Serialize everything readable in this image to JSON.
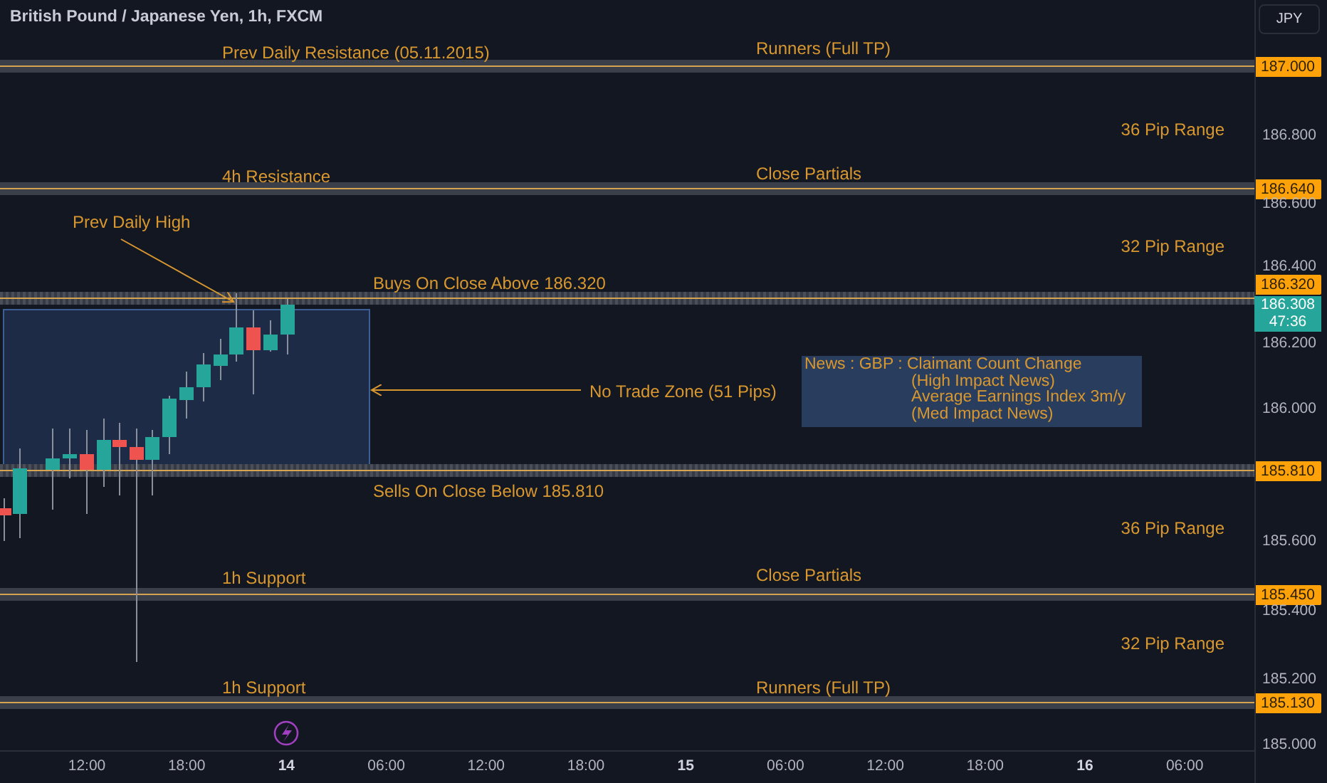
{
  "header": {
    "title": "British Pound / Japanese Yen, 1h, FXCM",
    "currency_button": "JPY"
  },
  "levels": [
    {
      "price": "187.000",
      "labels": [
        "Prev Daily Resistance (05.11.2015)",
        "Runners (Full TP)"
      ]
    },
    {
      "price": "186.640",
      "labels": [
        "4h Resistance",
        "Close Partials"
      ]
    },
    {
      "price": "186.320",
      "labels": [
        "Buys On Close Above 186.320"
      ]
    },
    {
      "price": "185.810",
      "labels": [
        "Sells On Close Below 185.810"
      ]
    },
    {
      "price": "185.450",
      "labels": [
        "1h Support",
        "Close Partials"
      ]
    },
    {
      "price": "185.130",
      "labels": [
        "1h Support",
        "Runners (Full TP)"
      ]
    }
  ],
  "ranges": [
    "36 Pip Range",
    "32 Pip Range",
    "36 Pip Range",
    "32 Pip Range"
  ],
  "prev_high_note": "Prev Daily High",
  "zone_note": "No Trade Zone (51 Pips)",
  "news": [
    "News : GBP : Claimant Count Change",
    "(High Impact News)",
    "Average Earnings Index 3m/y",
    "(Med Impact News)"
  ],
  "price_axis": [
    "186.800",
    "186.600",
    "186.400",
    "186.200",
    "186.000",
    "185.600",
    "185.400",
    "185.200",
    "185.000"
  ],
  "last_price": {
    "price": "186.308",
    "countdown": "47:36"
  },
  "time_axis": [
    {
      "label": "12:00",
      "kind": "time"
    },
    {
      "label": "18:00",
      "kind": "time"
    },
    {
      "label": "14",
      "kind": "day"
    },
    {
      "label": "06:00",
      "kind": "time"
    },
    {
      "label": "12:00",
      "kind": "time"
    },
    {
      "label": "18:00",
      "kind": "time"
    },
    {
      "label": "15",
      "kind": "day"
    },
    {
      "label": "06:00",
      "kind": "time"
    },
    {
      "label": "12:00",
      "kind": "time"
    },
    {
      "label": "18:00",
      "kind": "time"
    },
    {
      "label": "16",
      "kind": "day"
    },
    {
      "label": "06:00",
      "kind": "time"
    }
  ]
}
